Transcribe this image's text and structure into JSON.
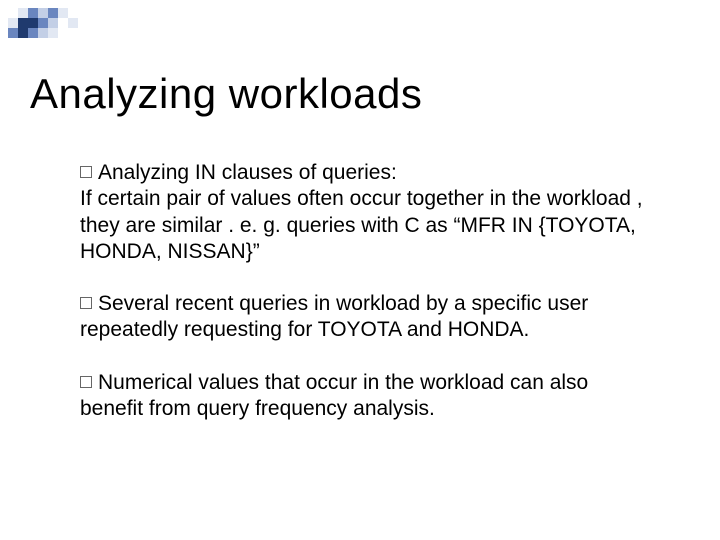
{
  "deco": {
    "colors": {
      "dark": "#1f3a6e",
      "mid": "#6a86bf",
      "light": "#c3cfe6",
      "pale": "#e2e8f3",
      "white": "#ffffff"
    }
  },
  "title": "Analyzing workloads",
  "bullets": [
    {
      "lead": "Analyzing IN clauses of queries:",
      "body": "If certain pair of values often occur together  in the workload , they are similar . e. g.  queries with C as “MFR IN {TOYOTA, HONDA, NISSAN}”"
    },
    {
      "lead": "Several recent queries in workload by a specific user",
      "body": "repeatedly requesting for TOYOTA and HONDA."
    },
    {
      "lead": "Numerical values that occur in the workload can also",
      "body": "benefit from query frequency analysis."
    }
  ]
}
